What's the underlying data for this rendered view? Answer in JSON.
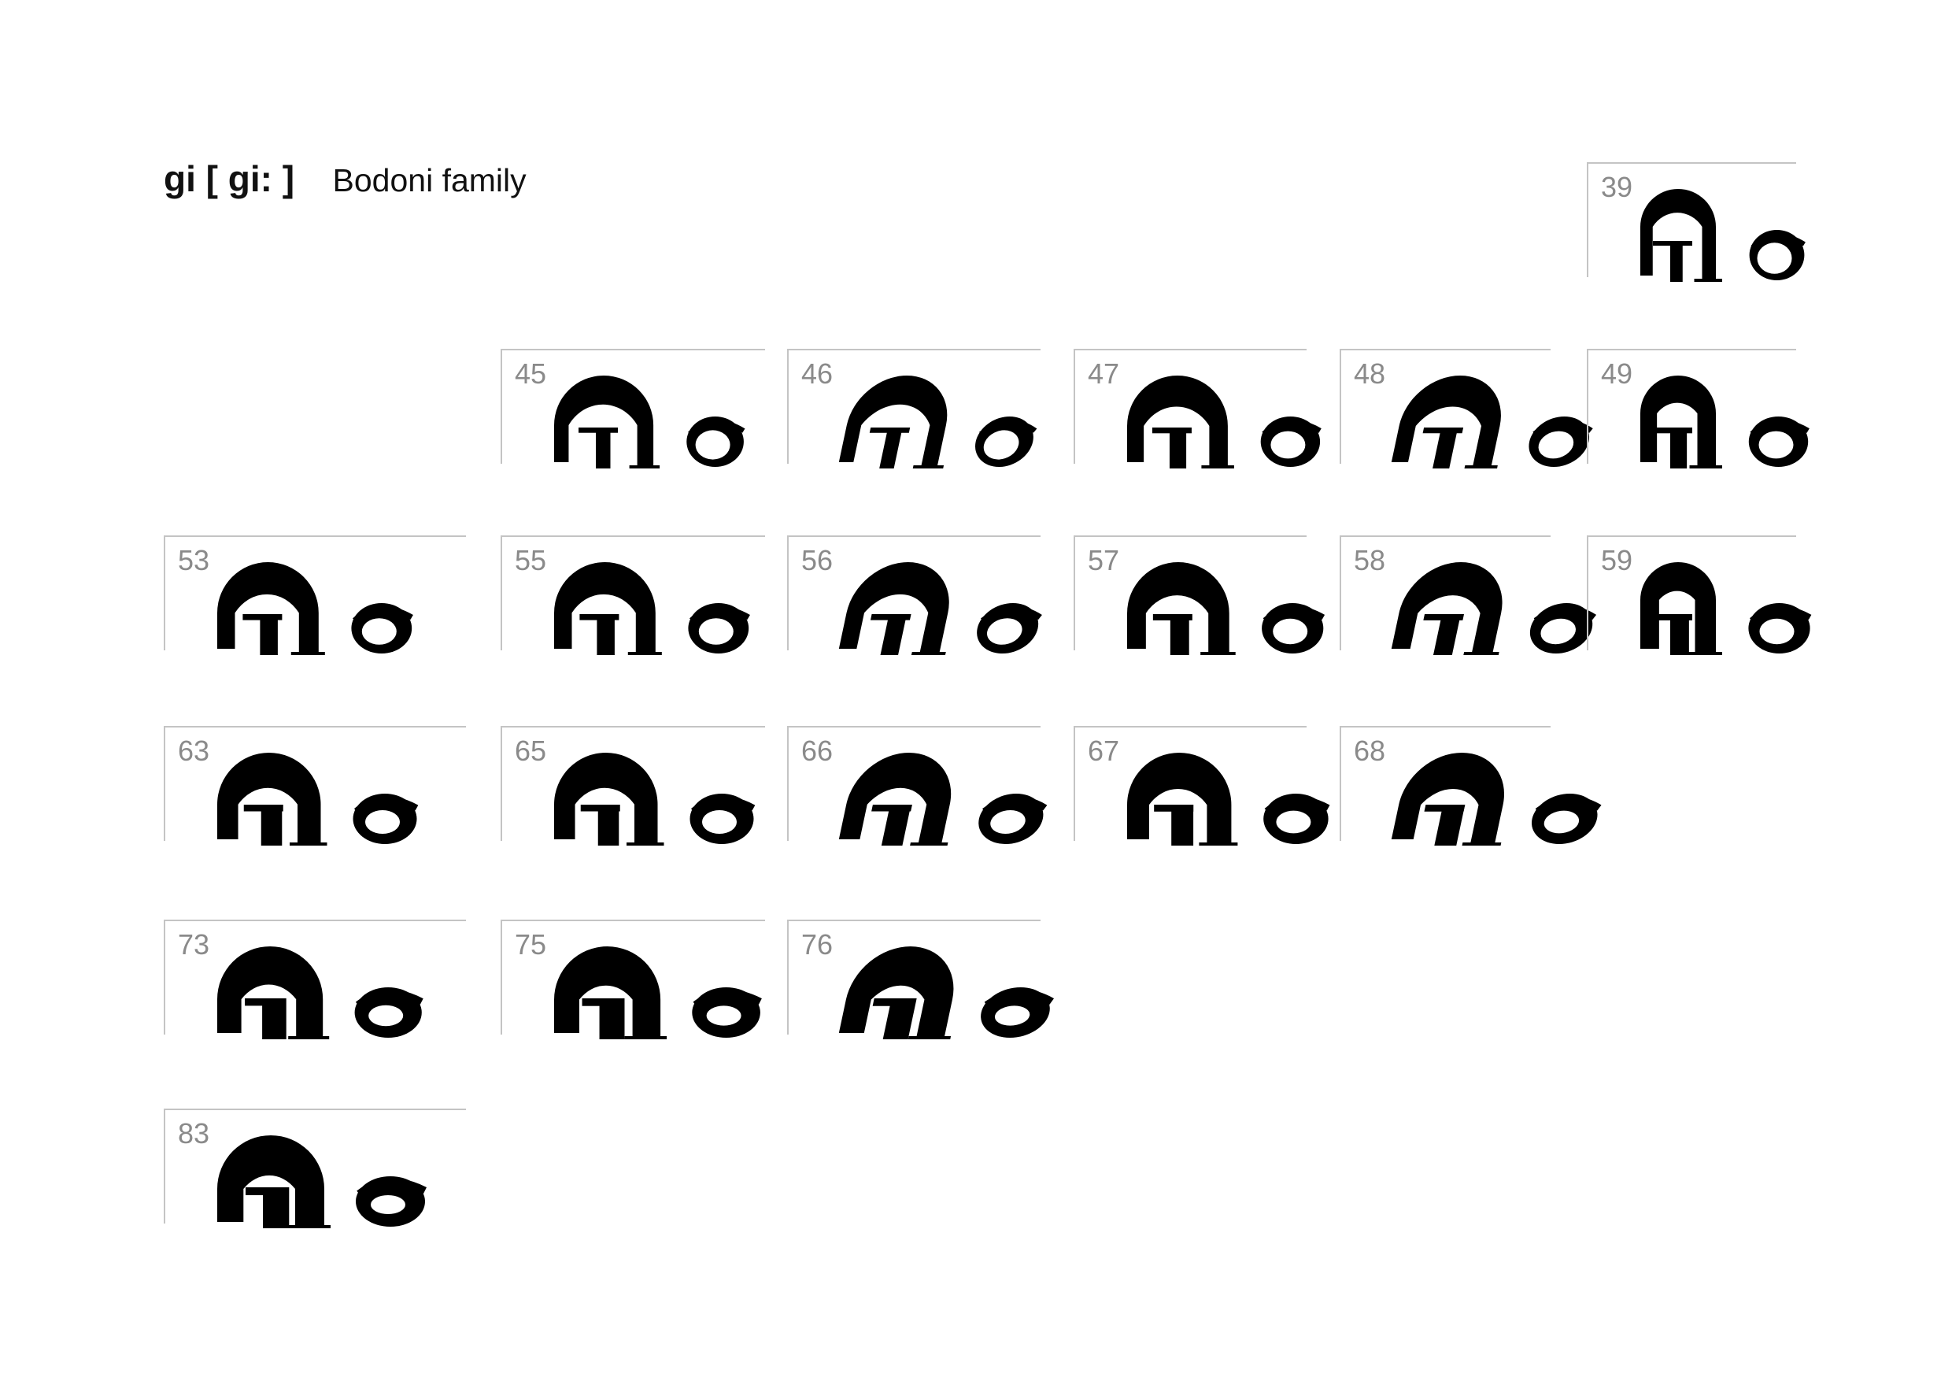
{
  "title": {
    "main": "gi [ gi: ]",
    "subtitle": "Bodoni family"
  },
  "specimens": [
    {
      "label": "39",
      "weight": 0.35,
      "italic": false,
      "condensed": true
    },
    {
      "label": "45",
      "weight": 0.45,
      "italic": false,
      "condensed": false
    },
    {
      "label": "46",
      "weight": 0.45,
      "italic": true,
      "condensed": false
    },
    {
      "label": "47",
      "weight": 0.55,
      "italic": false,
      "condensed": false
    },
    {
      "label": "48",
      "weight": 0.55,
      "italic": true,
      "condensed": false
    },
    {
      "label": "49",
      "weight": 0.55,
      "italic": false,
      "condensed": true
    },
    {
      "label": "53",
      "weight": 0.6,
      "italic": false,
      "condensed": false
    },
    {
      "label": "55",
      "weight": 0.6,
      "italic": false,
      "condensed": false
    },
    {
      "label": "56",
      "weight": 0.6,
      "italic": true,
      "condensed": false
    },
    {
      "label": "57",
      "weight": 0.65,
      "italic": false,
      "condensed": false
    },
    {
      "label": "58",
      "weight": 0.65,
      "italic": true,
      "condensed": false
    },
    {
      "label": "59",
      "weight": 0.65,
      "italic": false,
      "condensed": true
    },
    {
      "label": "63",
      "weight": 0.75,
      "italic": false,
      "condensed": false
    },
    {
      "label": "65",
      "weight": 0.75,
      "italic": false,
      "condensed": false
    },
    {
      "label": "66",
      "weight": 0.75,
      "italic": true,
      "condensed": false
    },
    {
      "label": "67",
      "weight": 0.8,
      "italic": false,
      "condensed": false
    },
    {
      "label": "68",
      "weight": 0.8,
      "italic": true,
      "condensed": false
    },
    {
      "label": "73",
      "weight": 0.9,
      "italic": false,
      "condensed": false
    },
    {
      "label": "75",
      "weight": 0.95,
      "italic": false,
      "condensed": false
    },
    {
      "label": "76",
      "weight": 0.95,
      "italic": true,
      "condensed": false
    },
    {
      "label": "83",
      "weight": 1.0,
      "italic": false,
      "condensed": false
    }
  ]
}
